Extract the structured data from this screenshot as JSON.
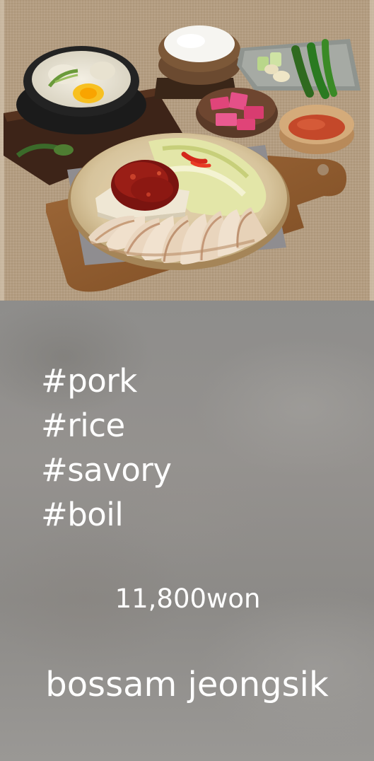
{
  "menu_card": {
    "hashtags": [
      "#pork",
      "#rice",
      "#savory",
      "#boil"
    ],
    "price": "11,800won",
    "dish_name": "bossam jeongsik"
  },
  "colors": {
    "text": "#ffffff",
    "info_background": "#8f8e8c",
    "tablecloth": "#b39a7e"
  }
}
